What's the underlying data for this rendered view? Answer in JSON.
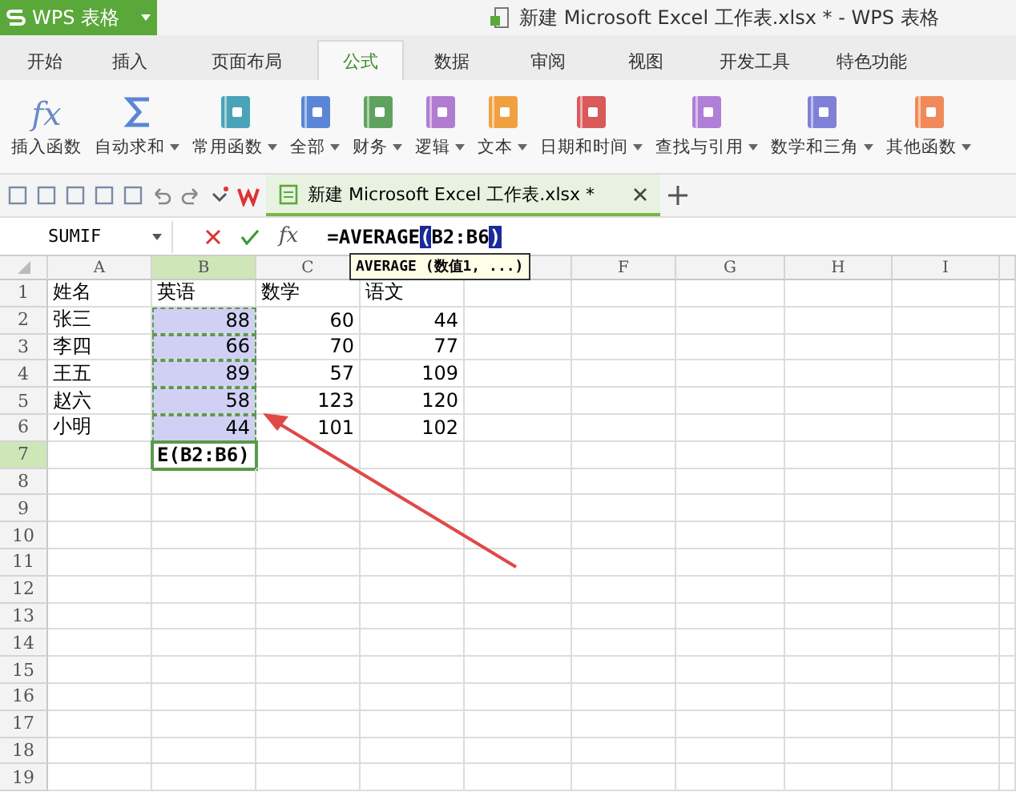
{
  "app_button": {
    "label": "WPS 表格"
  },
  "window": {
    "title": "新建 Microsoft Excel 工作表.xlsx * - WPS 表格"
  },
  "tabs": [
    {
      "label": "开始",
      "selected": false
    },
    {
      "label": "插入",
      "selected": false
    },
    {
      "label": "页面布局",
      "selected": false
    },
    {
      "label": "公式",
      "selected": true
    },
    {
      "label": "数据",
      "selected": false
    },
    {
      "label": "审阅",
      "selected": false
    },
    {
      "label": "视图",
      "selected": false
    },
    {
      "label": "开发工具",
      "selected": false
    },
    {
      "label": "特色功能",
      "selected": false
    }
  ],
  "ribbon": [
    {
      "kind": "fx",
      "label": "插入函数",
      "dropdown": false
    },
    {
      "kind": "sigma",
      "label": "自动求和",
      "dropdown": true
    },
    {
      "kind": "book",
      "label": "常用函数",
      "color": "#4aa3b8",
      "dropdown": true
    },
    {
      "kind": "book",
      "label": "全部",
      "color": "#5b86d6",
      "dropdown": true
    },
    {
      "kind": "book",
      "label": "财务",
      "color": "#5fa25f",
      "dropdown": true
    },
    {
      "kind": "book",
      "label": "逻辑",
      "color": "#b07cd0",
      "dropdown": true
    },
    {
      "kind": "book",
      "label": "文本",
      "color": "#f0a040",
      "dropdown": true
    },
    {
      "kind": "book",
      "label": "日期和时间",
      "color": "#d85a5a",
      "dropdown": true
    },
    {
      "kind": "book",
      "label": "查找与引用",
      "color": "#b080d8",
      "dropdown": true
    },
    {
      "kind": "book",
      "label": "数学和三角",
      "color": "#8080d8",
      "dropdown": true
    },
    {
      "kind": "book",
      "label": "其他函数",
      "color": "#f08a5a",
      "dropdown": true
    }
  ],
  "doc_tab": {
    "label": "新建 Microsoft Excel 工作表.xlsx *",
    "selected": true
  },
  "name_box": {
    "value": "SUMIF"
  },
  "fx_button": {
    "label": "fx"
  },
  "formula": [
    {
      "text": "=AVERAGE",
      "marked": false
    },
    {
      "text": "(",
      "marked": true
    },
    {
      "text": "B2:B6",
      "marked": false
    },
    {
      "text": ")",
      "marked": true
    }
  ],
  "tooltip": {
    "text": "AVERAGE (数值1, ...)"
  },
  "columns": [
    {
      "label": "A",
      "selected": false
    },
    {
      "label": "B",
      "selected": true
    },
    {
      "label": "C",
      "selected": false
    },
    null,
    {
      "selected": false
    },
    {
      "label": "F",
      "selected": false
    },
    {
      "label": "G",
      "selected": false
    },
    {
      "label": "H",
      "selected": false
    },
    {
      "label": "I",
      "selected": false
    }
  ],
  "rows": [
    {
      "label": "1",
      "selected": false,
      "cells": [
        {
          "text": "姓名",
          "in_range": false
        },
        {
          "text": "英语",
          "in_range": false
        },
        {
          "text": "数学",
          "in_range": false
        },
        {
          "text": "语文",
          "in_range": false
        }
      ]
    },
    {
      "label": "2",
      "selected": false,
      "cells": [
        {
          "text": "张三",
          "in_range": false
        },
        {
          "text": "88",
          "in_range": true
        },
        {
          "text": "60",
          "in_range": false
        },
        {
          "text": "44",
          "in_range": false
        }
      ]
    },
    {
      "label": "3",
      "selected": false,
      "cells": [
        {
          "text": "李四",
          "in_range": false
        },
        {
          "text": "66",
          "in_range": true
        },
        {
          "text": "70",
          "in_range": false
        },
        {
          "text": "77",
          "in_range": false
        }
      ]
    },
    {
      "label": "4",
      "selected": false,
      "cells": [
        {
          "text": "王五",
          "in_range": false
        },
        {
          "text": "89",
          "in_range": true
        },
        {
          "text": "57",
          "in_range": false
        },
        {
          "text": "109",
          "in_range": false
        }
      ]
    },
    {
      "label": "5",
      "selected": false,
      "cells": [
        {
          "text": "赵六",
          "in_range": false
        },
        {
          "text": "58",
          "in_range": true
        },
        {
          "text": "123",
          "in_range": false
        },
        {
          "text": "120",
          "in_range": false
        }
      ]
    },
    {
      "label": "6",
      "selected": false,
      "cells": [
        {
          "text": "小明",
          "in_range": false
        },
        {
          "text": "44",
          "in_range": true
        },
        {
          "text": "101",
          "in_range": false
        },
        {
          "text": "102",
          "in_range": false
        }
      ]
    },
    {
      "label": "7",
      "selected": true,
      "cells": [
        null,
        {
          "text": "E(B2:B6)",
          "in_range": false,
          "editing": true
        }
      ]
    },
    {
      "label": "8",
      "selected": false
    },
    {
      "label": "9",
      "selected": false
    },
    {
      "label": "10",
      "selected": false
    },
    {
      "label": "11",
      "selected": false
    },
    {
      "label": "12",
      "selected": false
    },
    {
      "label": "13",
      "selected": false
    },
    {
      "label": "14",
      "selected": false
    },
    {
      "label": "15",
      "selected": false
    },
    {
      "label": "16",
      "selected": false
    },
    {
      "label": "17",
      "selected": false
    },
    {
      "label": "18",
      "selected": false
    },
    {
      "label": "19",
      "selected": false
    }
  ]
}
